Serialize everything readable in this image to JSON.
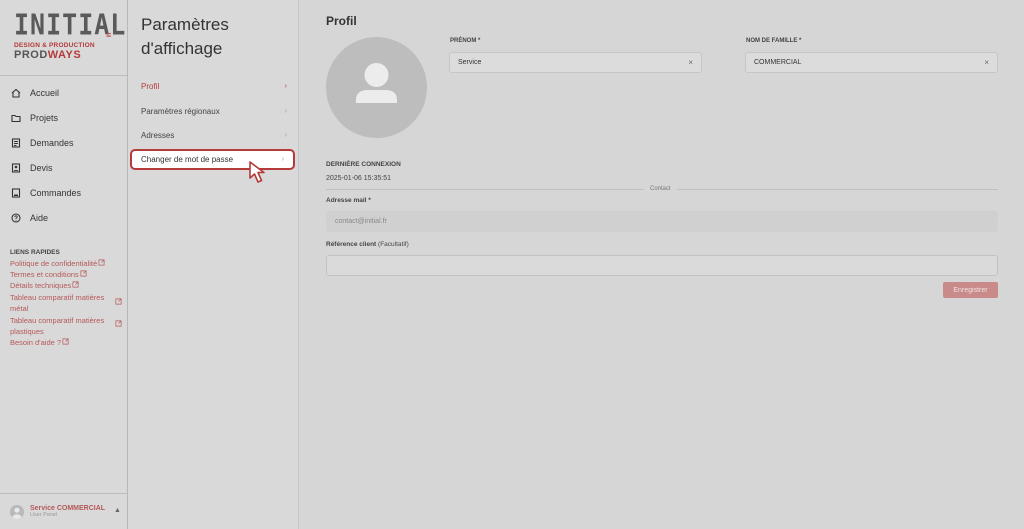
{
  "logo": {
    "brand": "INITIAL",
    "tagline": "DESIGN & PRODUCTION",
    "sub_brand_part1": "PROD",
    "sub_brand_part2": "WAYS"
  },
  "sidebar": {
    "items": [
      {
        "label": "Accueil",
        "icon": "home-icon"
      },
      {
        "label": "Projets",
        "icon": "folder-icon"
      },
      {
        "label": "Demandes",
        "icon": "request-icon"
      },
      {
        "label": "Devis",
        "icon": "quote-icon"
      },
      {
        "label": "Commandes",
        "icon": "order-icon"
      },
      {
        "label": "Aide",
        "icon": "help-icon"
      }
    ],
    "quick_links_title": "LIENS RAPIDES",
    "quick_links": [
      "Politique de confidentialité",
      "Termes et conditions",
      "Détails techniques",
      "Tableau comparatif matières métal",
      "Tableau comparatif matières plastiques",
      "Besoin d'aide ?"
    ],
    "user": {
      "name": "Service COMMERCIAL",
      "role": "User Panel"
    }
  },
  "settings": {
    "title": "Paramètres d'affichage",
    "items": [
      {
        "label": "Profil",
        "active": true
      },
      {
        "label": "Paramètres régionaux",
        "active": false
      },
      {
        "label": "Adresses",
        "active": false
      },
      {
        "label": "Changer de mot de passe",
        "active": false,
        "highlighted": true
      }
    ]
  },
  "profile": {
    "title": "Profil",
    "first_name_label": "PRÉNOM *",
    "first_name_value": "Service",
    "last_name_label": "NOM DE FAMILLE *",
    "last_name_value": "COMMERCIAL",
    "last_connection_label": "DERNIÈRE CONNEXION",
    "last_connection_value": "2025-01-06 15:35:51",
    "contact_divider": "Contact",
    "email_label": "Adresse mail *",
    "email_value": "contact@initial.fr",
    "reference_label": "Référence client",
    "reference_optional": "(Facultatif)",
    "reference_value": "",
    "save_label": "Enregistrer"
  },
  "colors": {
    "accent": "#b53a3a",
    "overlay_bg": "#d6d6d6",
    "save_button": "#c98a8a"
  }
}
